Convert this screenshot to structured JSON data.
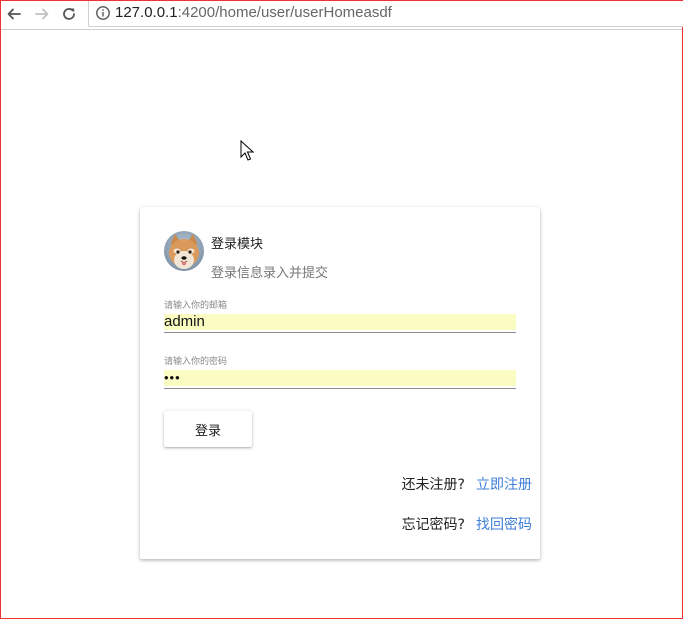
{
  "browser": {
    "url_host": "127.0.0.1",
    "url_path": ":4200/home/user/userHomeasdf",
    "icons": {
      "back": "arrow-left-icon",
      "forward": "arrow-right-icon",
      "reload": "reload-icon",
      "info": "info-icon"
    }
  },
  "card": {
    "title": "登录模块",
    "subtitle": "登录信息录入并提交",
    "avatar_icon": "dog-avatar-icon"
  },
  "form": {
    "email": {
      "label": "请输入你的邮箱",
      "value": "admin"
    },
    "password": {
      "label": "请输入你的密码",
      "value": "•••"
    },
    "submit_label": "登录"
  },
  "links": {
    "register_prompt": "还未注册?",
    "register_link": "立即注册",
    "forgot_prompt": "忘记密码?",
    "forgot_link": "找回密码"
  },
  "colors": {
    "link": "#3f7fd8",
    "autofill_bg": "#fbfcc2",
    "frame_border": "#ee3333"
  }
}
